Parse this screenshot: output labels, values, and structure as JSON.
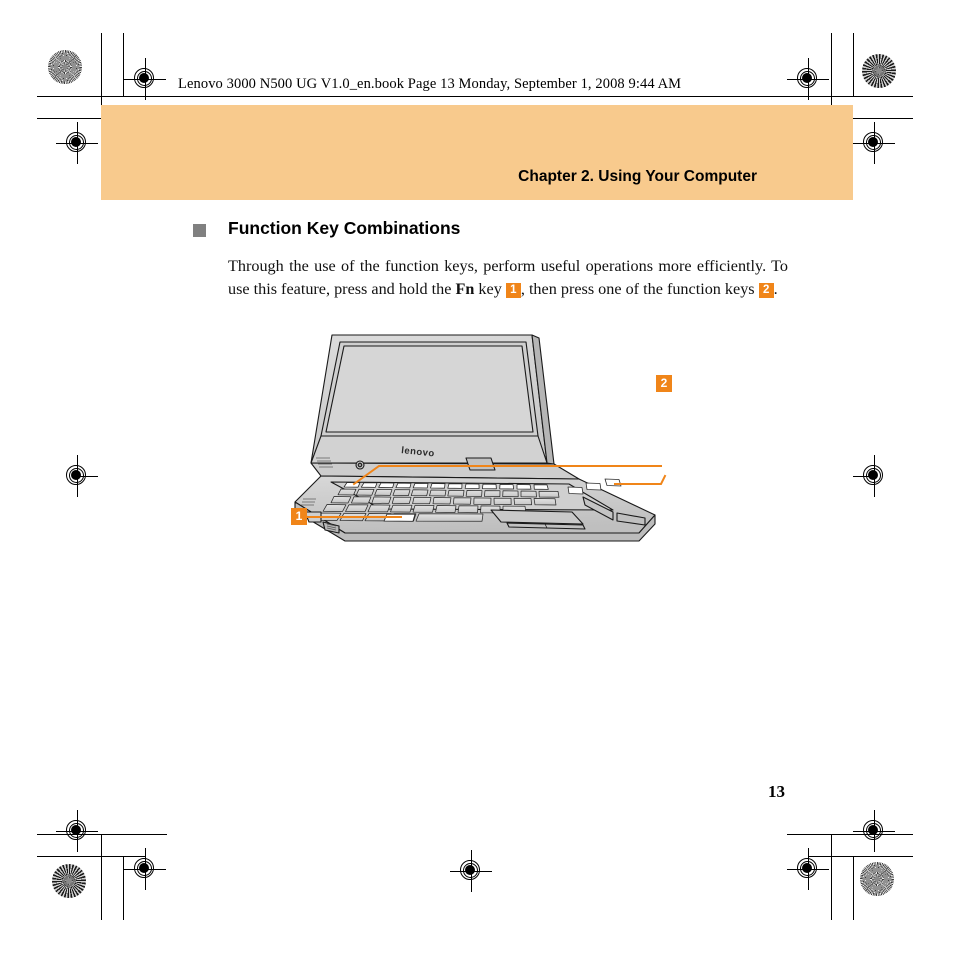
{
  "document": {
    "book_header": "Lenovo 3000 N500 UG V1.0_en.book  Page 13  Monday, September 1, 2008  9:44 AM",
    "page_number": "13",
    "banner_title": "Chapter 2. Using Your Computer",
    "banner_color": "#f8ca8d"
  },
  "section": {
    "bullet_icon": "square-bullet-icon",
    "heading": "Function Key Combinations",
    "paragraph": {
      "part1": "Through the use of the function keys, perform useful operations more efficiently. To use this feature, press and hold the ",
      "bold_term": "Fn",
      "part2": " key ",
      "badge1": "1",
      "part3": ", then press one of the function keys ",
      "badge2": "2",
      "part4": "."
    }
  },
  "figure": {
    "alt_name": "lenovo-notebook-illustration",
    "brand_logo": "lenovo",
    "callouts": [
      {
        "id": "1",
        "label": "1",
        "target": "fn-key"
      },
      {
        "id": "2",
        "label": "2",
        "target": "function-keys-row"
      }
    ],
    "accent_color": "#f08519"
  },
  "print_marks": {
    "registration_icon": "registration-target-icon",
    "rosette_icon": "print-rosette-icon",
    "crop_icon": "crop-mark-icon"
  }
}
